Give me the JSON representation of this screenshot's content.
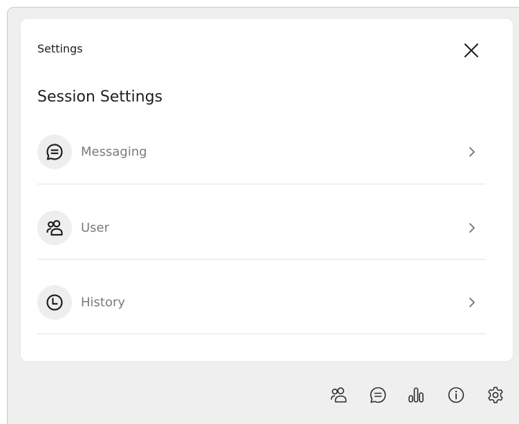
{
  "panel": {
    "title": "Settings",
    "section_title": "Session Settings",
    "items": [
      {
        "label": "Messaging",
        "icon": "chat-bubble-icon"
      },
      {
        "label": "User",
        "icon": "users-icon"
      },
      {
        "label": "History",
        "icon": "clock-icon"
      }
    ]
  },
  "toolbar": {
    "icons": [
      "users-icon",
      "chat-bubble-icon",
      "bar-chart-icon",
      "info-icon",
      "gear-icon"
    ]
  },
  "colors": {
    "background": "#efefef",
    "panel": "#ffffff",
    "text_primary": "#1e1e1e",
    "text_secondary": "#7a7a7a",
    "icon_circle": "#eeeeee"
  }
}
